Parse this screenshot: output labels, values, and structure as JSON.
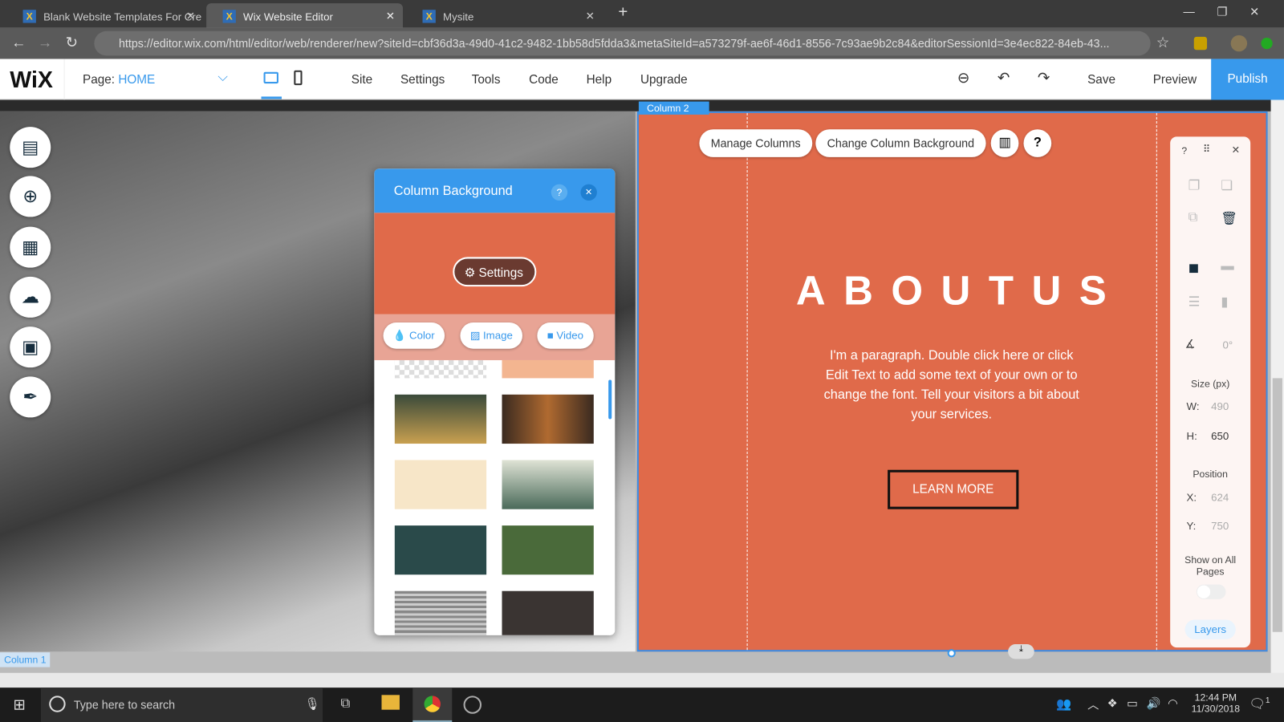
{
  "browser": {
    "tabs": [
      {
        "title": "Blank Website Templates For Cre",
        "active": false
      },
      {
        "title": "Wix Website Editor",
        "active": true
      },
      {
        "title": "Mysite",
        "active": false
      }
    ],
    "url": "https://editor.wix.com/html/editor/web/renderer/new?siteId=cbf36d3a-49d0-41c2-9482-1bb58d5fdda3&metaSiteId=a573279f-ae6f-46d1-8556-7c93ae9b2c84&editorSessionId=3e4ec822-84eb-43..."
  },
  "editor": {
    "logo": "WiX",
    "page_label": "Page:",
    "page_name": "HOME",
    "menu": [
      "Site",
      "Settings",
      "Tools",
      "Code",
      "Help",
      "Upgrade"
    ],
    "save": "Save",
    "preview": "Preview",
    "publish": "Publish",
    "accent": "#3899ec"
  },
  "canvas": {
    "column2_label": "Column 2",
    "column1_label": "Column 1",
    "manage_columns": "Manage Columns",
    "change_bg": "Change Column Background",
    "heading": "ABOUTUS",
    "paragraph": "I'm a paragraph. Double click here or click Edit Text to add some text of your own or to change the font. Tell your visitors a bit about your services.",
    "button": "LEARN MORE",
    "bg_color": "#e06a4a"
  },
  "bg_panel": {
    "title": "Column Background",
    "settings": "Settings",
    "tabs": [
      "Color",
      "Image",
      "Video"
    ]
  },
  "inspector": {
    "angle": "0°",
    "size_title": "Size (px)",
    "w_label": "W:",
    "w": "490",
    "h_label": "H:",
    "h": "650",
    "pos_title": "Position",
    "x_label": "X:",
    "x": "624",
    "y_label": "Y:",
    "y": "750",
    "show_all": "Show on All Pages",
    "layers": "Layers"
  },
  "taskbar": {
    "search": "Type here to search",
    "time": "12:44 PM",
    "date": "11/30/2018",
    "notif": "1"
  }
}
